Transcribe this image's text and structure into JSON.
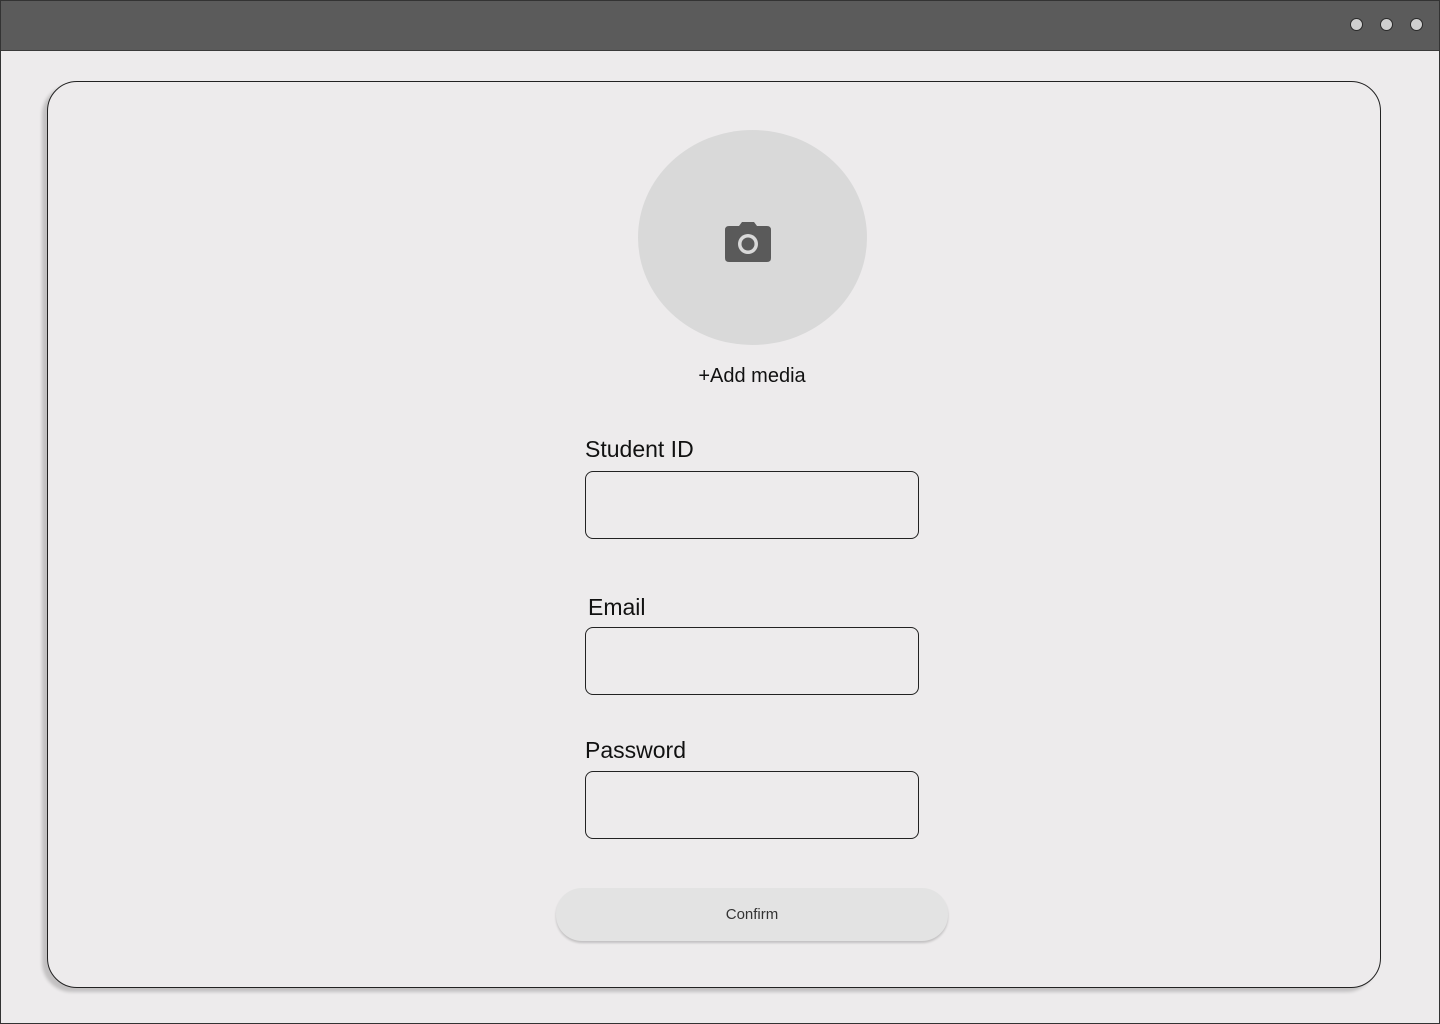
{
  "window": {
    "controls": [
      "window-dot",
      "window-dot",
      "window-dot"
    ]
  },
  "form": {
    "avatar_icon": "camera-icon",
    "add_media_label": "+Add media",
    "student_id_label": "Student ID",
    "student_id_value": "",
    "email_label": "Email",
    "email_value": "",
    "password_label": "Password",
    "password_value": "",
    "confirm_label": "Confirm"
  },
  "colors": {
    "titlebar": "#5b5b5b",
    "background": "#edebec",
    "avatar": "#d9d9d9",
    "icon": "#5a5a5a",
    "button": "#e3e3e3"
  }
}
